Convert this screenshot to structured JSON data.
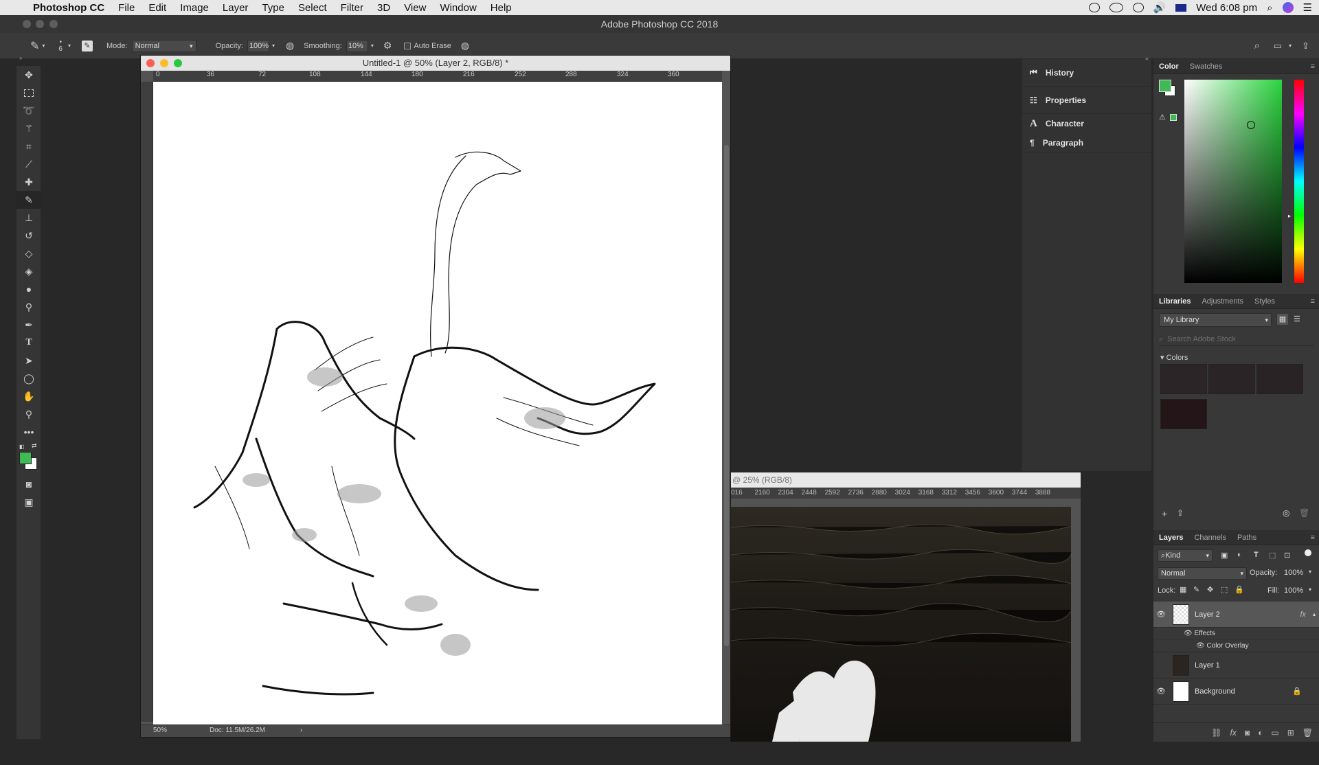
{
  "menubar": {
    "app": "Photoshop CC",
    "items": [
      "File",
      "Edit",
      "Image",
      "Layer",
      "Type",
      "Select",
      "Filter",
      "3D",
      "View",
      "Window",
      "Help"
    ],
    "clock": "Wed 6:08 pm"
  },
  "window_title": "Adobe Photoshop CC 2018",
  "options": {
    "brush_size": "6",
    "mode_label": "Mode:",
    "mode_value": "Normal",
    "opacity_label": "Opacity:",
    "opacity_value": "100%",
    "smoothing_label": "Smoothing:",
    "smoothing_value": "10%",
    "auto_erase_label": "Auto Erase"
  },
  "tools": [
    "move-tool",
    "marquee-tool",
    "lasso-tool",
    "magic-wand-tool",
    "crop-tool",
    "eyedropper-tool",
    "healing-brush-tool",
    "pencil-tool",
    "clone-stamp-tool",
    "history-brush-tool",
    "eraser-tool",
    "paint-bucket-tool",
    "blur-tool",
    "dodge-tool",
    "pen-tool",
    "type-tool",
    "path-selection-tool",
    "ellipse-tool",
    "hand-tool",
    "zoom-tool",
    "more-tools"
  ],
  "doc1": {
    "title": "Untitled-1 @ 50% (Layer 2, RGB/8) *",
    "ruler_ticks": [
      "0",
      "36",
      "72",
      "108",
      "144",
      "180",
      "216",
      "252",
      "288",
      "324",
      "360"
    ],
    "zoom": "50%",
    "doc_size": "Doc: 11.5M/26.2M"
  },
  "doc2": {
    "title": "@ 25% (RGB/8)",
    "ruler_ticks": [
      "016",
      "2160",
      "2304",
      "2448",
      "2592",
      "2736",
      "2880",
      "3024",
      "3168",
      "3312",
      "3456",
      "3600",
      "3744",
      "3888"
    ]
  },
  "dock": {
    "items": [
      "History",
      "Properties",
      "Character",
      "Paragraph"
    ]
  },
  "color_panel": {
    "tabs": [
      "Color",
      "Swatches"
    ],
    "foreground": "#3fba55",
    "background": "#ffffff"
  },
  "libraries_panel": {
    "tabs": [
      "Libraries",
      "Adjustments",
      "Styles"
    ],
    "library": "My Library",
    "search_placeholder": "Search Adobe Stock",
    "colors_heading": "Colors",
    "swatches": [
      "#2c2527",
      "#2b2426",
      "#2a2325",
      "#231518"
    ]
  },
  "layers_panel": {
    "tabs": [
      "Layers",
      "Channels",
      "Paths"
    ],
    "filter": "Kind",
    "blend_mode": "Normal",
    "opacity_label": "Opacity:",
    "opacity": "100%",
    "lock_label": "Lock:",
    "fill_label": "Fill:",
    "fill": "100%",
    "layers": [
      {
        "name": "Layer 2",
        "visible": true,
        "selected": true
      },
      {
        "name": "Layer 1",
        "visible": false,
        "selected": false
      },
      {
        "name": "Background",
        "visible": true,
        "selected": false
      }
    ],
    "effects_label": "Effects",
    "color_overlay_label": "Color Overlay"
  }
}
